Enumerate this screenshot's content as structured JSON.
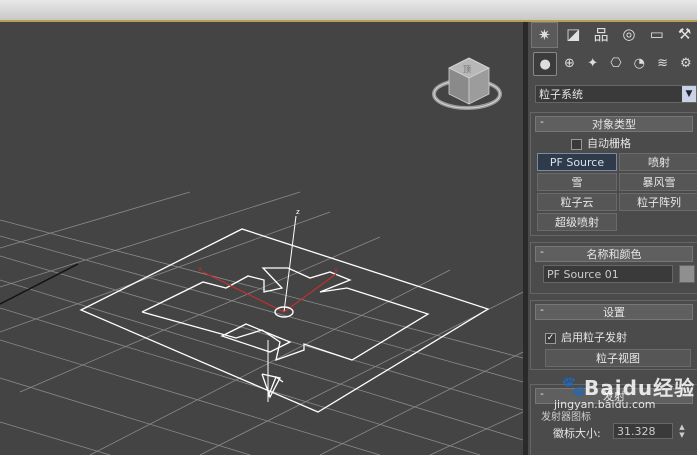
{
  "viewport": {
    "axis_label": "z",
    "viewcube_label": "顶"
  },
  "command_panel": {
    "tabs": [
      {
        "name": "create-tab",
        "glyph": "✷"
      },
      {
        "name": "modify-tab",
        "glyph": "◪"
      },
      {
        "name": "hierarchy-tab",
        "glyph": "品"
      },
      {
        "name": "motion-tab",
        "glyph": "◎"
      },
      {
        "name": "display-tab",
        "glyph": "▭"
      },
      {
        "name": "utilities-tab",
        "glyph": "⚒"
      }
    ],
    "subcategories": [
      {
        "name": "geometry-icon",
        "glyph": "●"
      },
      {
        "name": "shapes-icon",
        "glyph": "⊕"
      },
      {
        "name": "lights-icon",
        "glyph": "✦"
      },
      {
        "name": "cameras-icon",
        "glyph": "⎔"
      },
      {
        "name": "helpers-icon",
        "glyph": "◔"
      },
      {
        "name": "spacewarps-icon",
        "glyph": "≋"
      },
      {
        "name": "systems-icon",
        "glyph": "⚙"
      }
    ],
    "category_dropdown": "粒子系统",
    "object_type": {
      "title": "对象类型",
      "autogrid_label": "自动栅格",
      "buttons": [
        "PF Source",
        "喷射",
        "雪",
        "暴风雪",
        "粒子云",
        "粒子阵列",
        "超级喷射"
      ]
    },
    "name_color": {
      "title": "名称和颜色",
      "name_value": "PF Source 01",
      "color": "#8f8f8f"
    },
    "setup": {
      "title": "设置",
      "enable_label": "启用粒子发射",
      "view_button": "粒子视图"
    },
    "emission": {
      "title": "发射",
      "sub_label": "发射器图标",
      "logo_size_label": "徽标大小:",
      "logo_size_value": "31.328"
    }
  },
  "watermark": {
    "text": "Baidu经验",
    "url": "jingyan.baidu.com"
  },
  "colors": {
    "viewport_bg": "#444444",
    "grid": "#8a8a8a",
    "gizmo": "#ffffff",
    "axis_red": "#c03030"
  }
}
